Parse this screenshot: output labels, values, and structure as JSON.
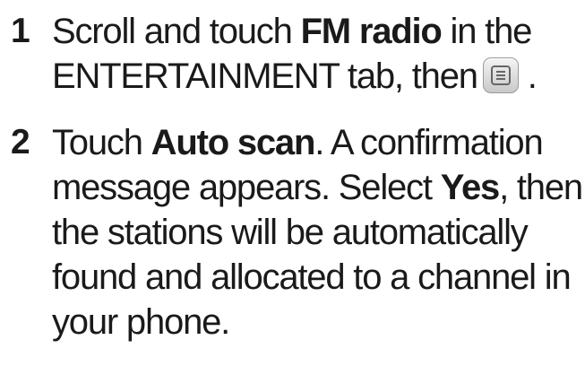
{
  "steps": [
    {
      "number": "1",
      "parts": {
        "a": "Scroll and touch ",
        "b": "FM radio",
        "c": " in the ENTERTAINMENT tab, then",
        "d": "."
      }
    },
    {
      "number": "2",
      "parts": {
        "a": "Touch ",
        "b": "Auto scan",
        "c": ". A confirmation message appears. Select ",
        "d": "Yes",
        "e": ", then the stations will be automatically found and allocated to a channel in your phone."
      }
    }
  ],
  "icons": {
    "menu_key": "menu-icon"
  }
}
